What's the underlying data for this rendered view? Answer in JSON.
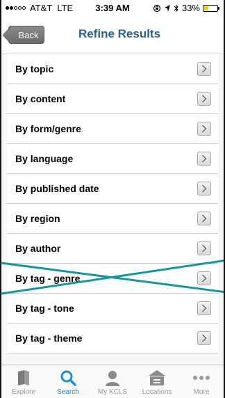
{
  "status": {
    "carrier": "AT&T",
    "network": "LTE",
    "time": "3:39 AM",
    "battery": "33%",
    "battery_level": 0.33
  },
  "nav": {
    "back_label": "Back",
    "title": "Refine Results"
  },
  "list": {
    "items": [
      {
        "label": "By topic"
      },
      {
        "label": "By content"
      },
      {
        "label": "By form/genre"
      },
      {
        "label": "By language"
      },
      {
        "label": "By published date"
      },
      {
        "label": "By region"
      },
      {
        "label": "By author"
      },
      {
        "label": "By tag - genre",
        "struck": true
      },
      {
        "label": "By tag - tone"
      },
      {
        "label": "By tag - theme"
      }
    ]
  },
  "tabs": [
    {
      "label": "Explore",
      "icon": "book-icon"
    },
    {
      "label": "Search",
      "icon": "search-icon",
      "active": true
    },
    {
      "label": "My KCLS",
      "icon": "user-icon"
    },
    {
      "label": "Locations",
      "icon": "building-icon"
    },
    {
      "label": "More",
      "icon": "more-icon"
    }
  ],
  "colors": {
    "title": "#2c5f8a",
    "strike": "#17959c",
    "tab_active": "#1a8fd6"
  }
}
